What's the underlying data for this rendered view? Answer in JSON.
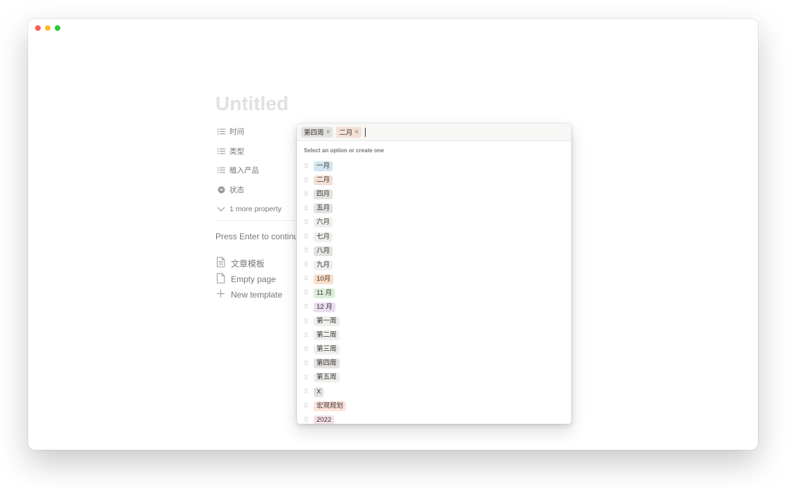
{
  "window": {
    "traffic_lights": {
      "close": "#ff5f57",
      "minimize": "#febc2e",
      "zoom": "#28c840"
    }
  },
  "page": {
    "title": "Untitled",
    "properties": [
      {
        "icon": "list-icon",
        "label": "时间"
      },
      {
        "icon": "list-icon",
        "label": "类型"
      },
      {
        "icon": "list-icon",
        "label": "植入产品"
      },
      {
        "icon": "status-icon",
        "label": "状态"
      }
    ],
    "more_properties": "1 more property",
    "press_enter_text": "Press Enter to continue",
    "templates": [
      {
        "icon": "document-icon",
        "label": "文章模板"
      },
      {
        "icon": "empty-page-icon",
        "label": "Empty page"
      },
      {
        "icon": "plus-icon",
        "label": "New template"
      }
    ]
  },
  "dropdown": {
    "selected": [
      {
        "label": "第四周",
        "color": "#e3e2e0",
        "remove": "×"
      },
      {
        "label": "二月",
        "color": "#f4dfd5",
        "remove": "×"
      }
    ],
    "hint": "Select an option or create one",
    "options": [
      {
        "label": "一月",
        "color": "#d3e5ef"
      },
      {
        "label": "二月",
        "color": "#f4dfd5"
      },
      {
        "label": "四月",
        "color": "#e3e2e0"
      },
      {
        "label": "五月",
        "color": "#e3e2e0"
      },
      {
        "label": "六月",
        "color": "#efefed"
      },
      {
        "label": "七月",
        "color": "#efefed"
      },
      {
        "label": "八月",
        "color": "#e3e2e0"
      },
      {
        "label": "九月",
        "color": "#efefed"
      },
      {
        "label": "10月",
        "color": "#fadec9"
      },
      {
        "label": "11 月",
        "color": "#dbeddb"
      },
      {
        "label": "12 月",
        "color": "#e8deee"
      },
      {
        "label": "第一周",
        "color": "#efefed"
      },
      {
        "label": "第二周",
        "color": "#efefed"
      },
      {
        "label": "第三周",
        "color": "#efefed"
      },
      {
        "label": "第四周",
        "color": "#e3e2e0"
      },
      {
        "label": "第五周",
        "color": "#efefed"
      },
      {
        "label": "X",
        "color": "#e3e2e0"
      },
      {
        "label": "宏观规划",
        "color": "#ffe2dd"
      },
      {
        "label": "2022",
        "color": "#f5e0e9"
      }
    ]
  }
}
